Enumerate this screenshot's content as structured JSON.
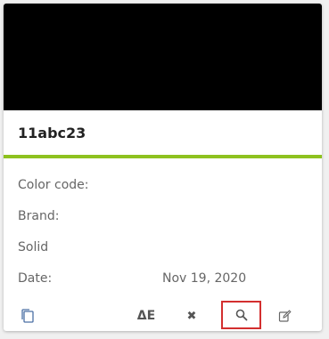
{
  "card": {
    "swatch_color": "#000000",
    "title": "11abc23",
    "accent_color": "#8ec21f",
    "rows": [
      {
        "label": "Color code:",
        "value": ""
      },
      {
        "label": "Brand:",
        "value": ""
      },
      {
        "label": "Solid",
        "value": ""
      },
      {
        "label": "Date:",
        "value": "Nov 19, 2020"
      }
    ]
  },
  "actions": {
    "copy_icon": "copy-icon",
    "delta_label": "ΔE",
    "close_glyph": "✖",
    "search_icon": "search-icon",
    "edit_icon": "edit-icon",
    "highlight_color": "#d32f2f"
  }
}
